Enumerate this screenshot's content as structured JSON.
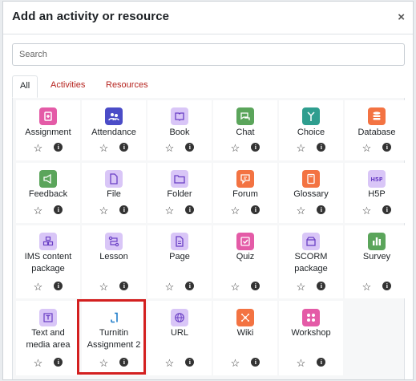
{
  "modal": {
    "title": "Add an activity or resource",
    "close_symbol": "×",
    "search_placeholder": "Search",
    "tabs": [
      {
        "label": "All"
      },
      {
        "label": "Activities"
      },
      {
        "label": "Resources"
      }
    ],
    "star_symbol": "☆",
    "info_symbol": "i"
  },
  "colors": {
    "purple": "#d9c6f7",
    "green": "#5ba55b",
    "orange": "#f37342",
    "pink": "#e45ba7",
    "blue_outline": "#1f7cc9",
    "highlight": "#d32020"
  },
  "activities": [
    {
      "label": "Assignment",
      "icon": "assignment-icon"
    },
    {
      "label": "Attendance",
      "icon": "attendance-icon"
    },
    {
      "label": "Book",
      "icon": "book-icon"
    },
    {
      "label": "Chat",
      "icon": "chat-icon"
    },
    {
      "label": "Choice",
      "icon": "choice-icon"
    },
    {
      "label": "Database",
      "icon": "database-icon"
    },
    {
      "label": "Feedback",
      "icon": "feedback-icon"
    },
    {
      "label": "File",
      "icon": "file-icon"
    },
    {
      "label": "Folder",
      "icon": "folder-icon"
    },
    {
      "label": "Forum",
      "icon": "forum-icon"
    },
    {
      "label": "Glossary",
      "icon": "glossary-icon"
    },
    {
      "label": "H5P",
      "icon": "h5p-icon"
    },
    {
      "label": "IMS content package",
      "icon": "ims-package-icon"
    },
    {
      "label": "Lesson",
      "icon": "lesson-icon"
    },
    {
      "label": "Page",
      "icon": "page-icon"
    },
    {
      "label": "Quiz",
      "icon": "quiz-icon"
    },
    {
      "label": "SCORM package",
      "icon": "scorm-icon"
    },
    {
      "label": "Survey",
      "icon": "survey-icon"
    },
    {
      "label": "Text and media area",
      "icon": "text-media-icon"
    },
    {
      "label": "Turnitin Assignment 2",
      "icon": "turnitin-icon"
    },
    {
      "label": "URL",
      "icon": "url-icon"
    },
    {
      "label": "Wiki",
      "icon": "wiki-icon"
    },
    {
      "label": "Workshop",
      "icon": "workshop-icon"
    }
  ]
}
